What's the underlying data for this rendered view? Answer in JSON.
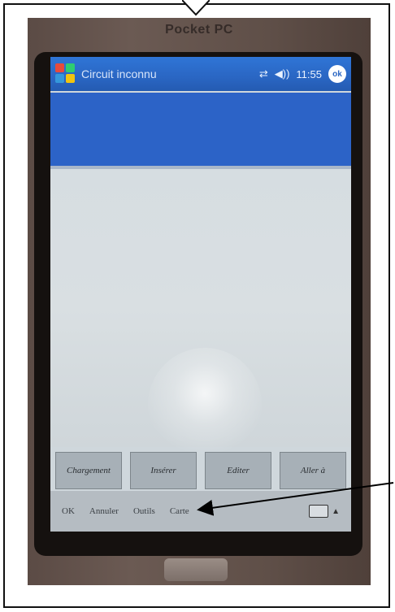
{
  "device": {
    "brand": "Pocket PC"
  },
  "titlebar": {
    "app_title": "Circuit inconnu",
    "time": "11:55",
    "ok_label": "ok"
  },
  "buttons": [
    "Chargement",
    "Insérer",
    "Editer",
    "Aller à"
  ],
  "menubar": [
    "OK",
    "Annuler",
    "Outils",
    "Carte"
  ],
  "colors": {
    "titlebar": "#2a66c3",
    "header_band": "#2c63c7"
  }
}
